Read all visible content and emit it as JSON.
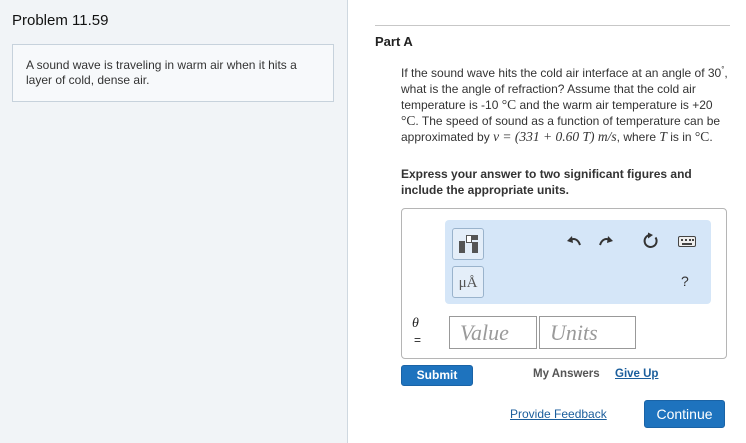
{
  "problem": {
    "title": "Problem 11.59",
    "intro": "A sound wave is traveling in warm air when it hits a layer of cold, dense air."
  },
  "part": {
    "title": "Part A",
    "question": {
      "t1": "If the sound wave hits the cold air interface at an angle of 30",
      "deg": "°",
      "t2": ", what is the angle of refraction? Assume that the cold air temperature is -10",
      "unit_c": "°C",
      "t3": " and the warm air temperature is +20",
      "t4": ". The speed of sound as a function of temperature can be approximated by",
      "formula": "v = (331 + 0.60 T) m/s",
      "t5": ", where",
      "var_t": "T",
      "t6": " is in"
    },
    "instruction": "Express your answer to two significant figures and include the appropriate units."
  },
  "toolbar": {
    "units_button_label": "μÅ",
    "help_label": "?"
  },
  "answer": {
    "variable": "θ",
    "equals": "=",
    "value_placeholder": "Value",
    "units_placeholder": "Units"
  },
  "actions": {
    "submit": "Submit",
    "my_answers": "My Answers",
    "give_up": "Give Up",
    "provide_feedback": "Provide Feedback",
    "continue": "Continue"
  }
}
